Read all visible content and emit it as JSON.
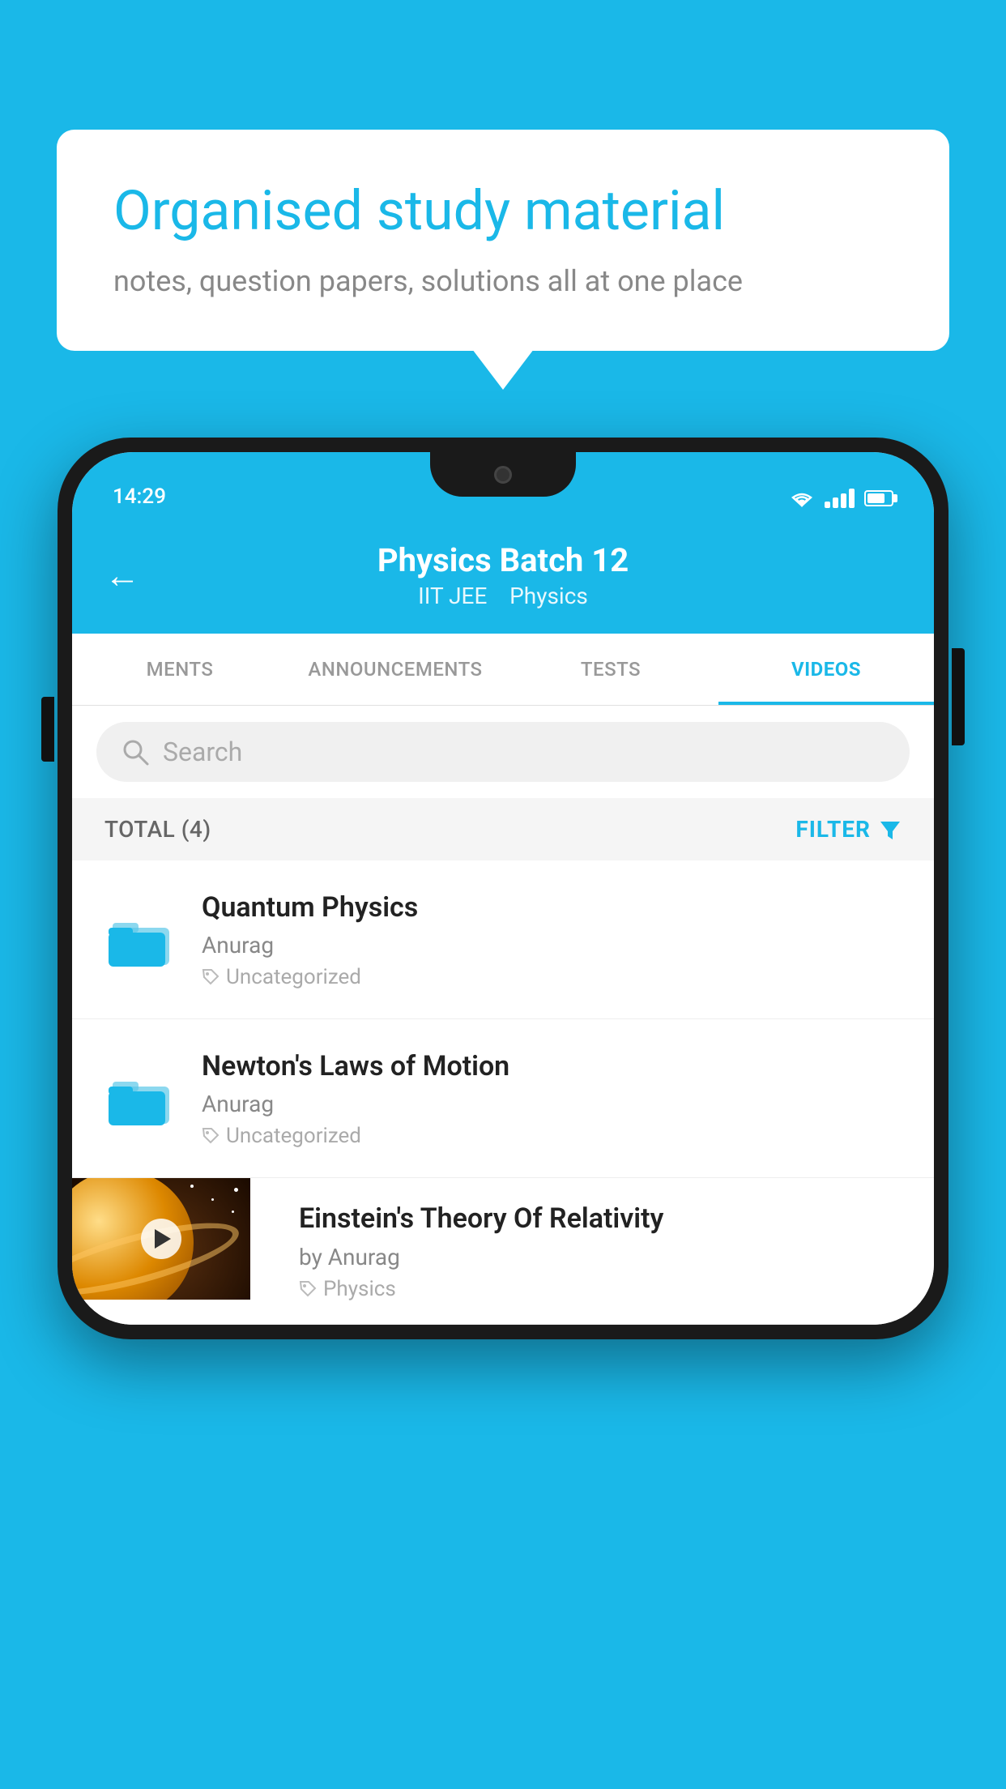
{
  "page": {
    "background_color": "#1ab8e8"
  },
  "speech_bubble": {
    "title": "Organised study material",
    "subtitle": "notes, question papers, solutions all at one place"
  },
  "phone": {
    "status_bar": {
      "time": "14:29"
    },
    "header": {
      "back_label": "←",
      "title": "Physics Batch 12",
      "subtitle_part1": "IIT JEE",
      "subtitle_part2": "Physics"
    },
    "tabs": [
      {
        "label": "MENTS",
        "active": false
      },
      {
        "label": "ANNOUNCEMENTS",
        "active": false
      },
      {
        "label": "TESTS",
        "active": false
      },
      {
        "label": "VIDEOS",
        "active": true
      }
    ],
    "search": {
      "placeholder": "Search"
    },
    "filter": {
      "total_label": "TOTAL (4)",
      "filter_label": "FILTER"
    },
    "videos": [
      {
        "title": "Quantum Physics",
        "author": "Anurag",
        "tag": "Uncategorized",
        "type": "folder",
        "has_thumbnail": false
      },
      {
        "title": "Newton's Laws of Motion",
        "author": "Anurag",
        "tag": "Uncategorized",
        "type": "folder",
        "has_thumbnail": false
      },
      {
        "title": "Einstein's Theory Of Relativity",
        "author": "by Anurag",
        "tag": "Physics",
        "type": "video",
        "has_thumbnail": true
      }
    ]
  }
}
